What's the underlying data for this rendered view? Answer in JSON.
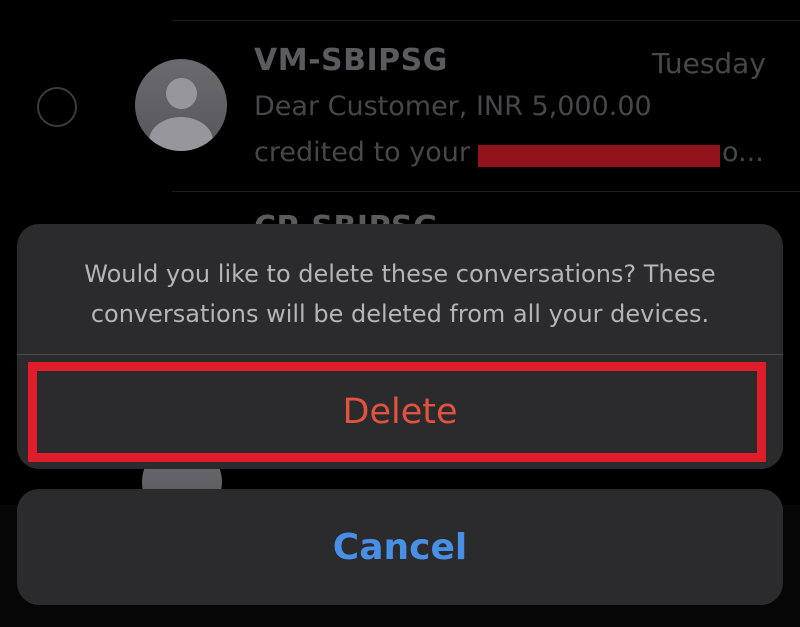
{
  "messages": [
    {
      "sender": "VM-SBIPSG",
      "date": "Tuesday",
      "preview_line1": "Dear Customer, INR 5,000.00",
      "preview_line2_start": "credited to your",
      "preview_line2_end": "o..."
    },
    {
      "sender": "CP-SBIPSG",
      "date": ""
    }
  ],
  "dialog": {
    "message": "Would you like to delete these conversations? These conversations will be deleted from all your devices.",
    "message_line1": "Would you like to delete these conversations? These",
    "message_line2": "conversations will be deleted from all your devices.",
    "delete_label": "Delete",
    "cancel_label": "Cancel"
  },
  "colors": {
    "destructive": "#e0533f",
    "accent": "#4a8fe6",
    "highlight": "#e01e2b",
    "sheet_bg": "#2b2b2d"
  }
}
